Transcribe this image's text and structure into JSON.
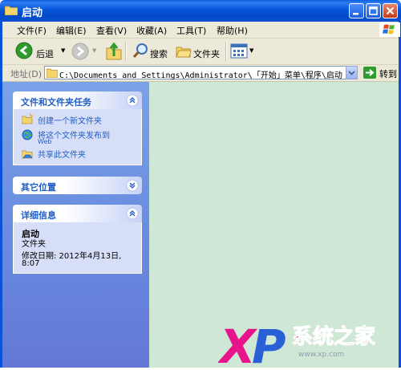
{
  "window": {
    "title": "启动"
  },
  "menu": [
    "文件(F)",
    "编辑(E)",
    "查看(V)",
    "收藏(A)",
    "工具(T)",
    "帮助(H)"
  ],
  "toolbar": {
    "back": "后退",
    "search": "搜索",
    "folders": "文件夹"
  },
  "address": {
    "label": "地址(D)",
    "path": "C:\\Documents and Settings\\Administrator\\「开始」菜单\\程序\\启动",
    "go": "转到"
  },
  "panels": {
    "tasks": {
      "title": "文件和文件夹任务",
      "items": [
        "创建一个新文件夹",
        "将这个文件夹发布到",
        "Web",
        "共享此文件夹"
      ]
    },
    "places": {
      "title": "其它位置"
    },
    "details": {
      "title": "详细信息",
      "name": "启动",
      "type": "文件夹",
      "modified_1": "修改日期: 2012年4月13日,",
      "modified_2": "8:07"
    }
  },
  "watermark": {
    "brand": "XP",
    "text": "系统之家"
  },
  "colors": {
    "titlebar": "#0556d9",
    "sidebar": "#6a8de0",
    "filepane": "#cfe8d6",
    "panel_title": "#215dc6",
    "brand_pink": "#e8148c",
    "brand_red": "#e2232a"
  }
}
